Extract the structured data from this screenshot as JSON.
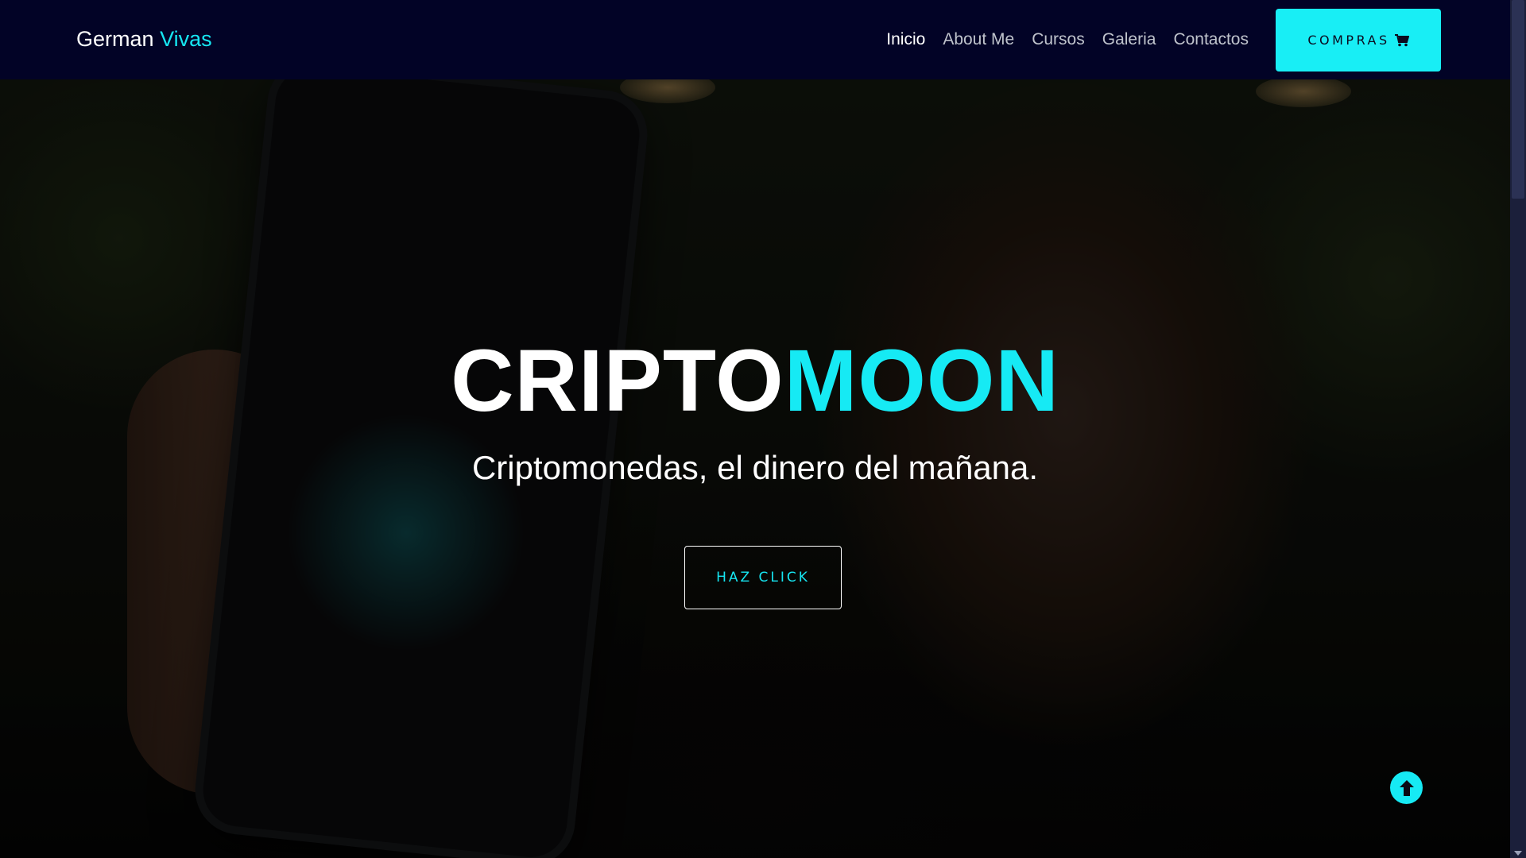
{
  "navbar": {
    "brand_first": "German",
    "brand_second": "Vivas",
    "links": [
      {
        "label": "Inicio",
        "active": true
      },
      {
        "label": "About Me",
        "active": false
      },
      {
        "label": "Cursos",
        "active": false
      },
      {
        "label": "Galeria",
        "active": false
      },
      {
        "label": "Contactos",
        "active": false
      }
    ],
    "cart_button": {
      "label": "COMPRAS",
      "icon": "shopping-cart-icon"
    }
  },
  "hero": {
    "title_white": "CRIPTO",
    "title_accent": "MOON",
    "subtitle": "Criptomonedas, el dinero del mañana.",
    "cta_label": "HAZ CLICK"
  },
  "scroll_top": {
    "icon": "arrow-up-circle-icon"
  },
  "colors": {
    "accent": "#16eaf4",
    "navbar_bg": "#020326",
    "text_light": "#ffffff",
    "nav_link": "#bfc3cc"
  }
}
